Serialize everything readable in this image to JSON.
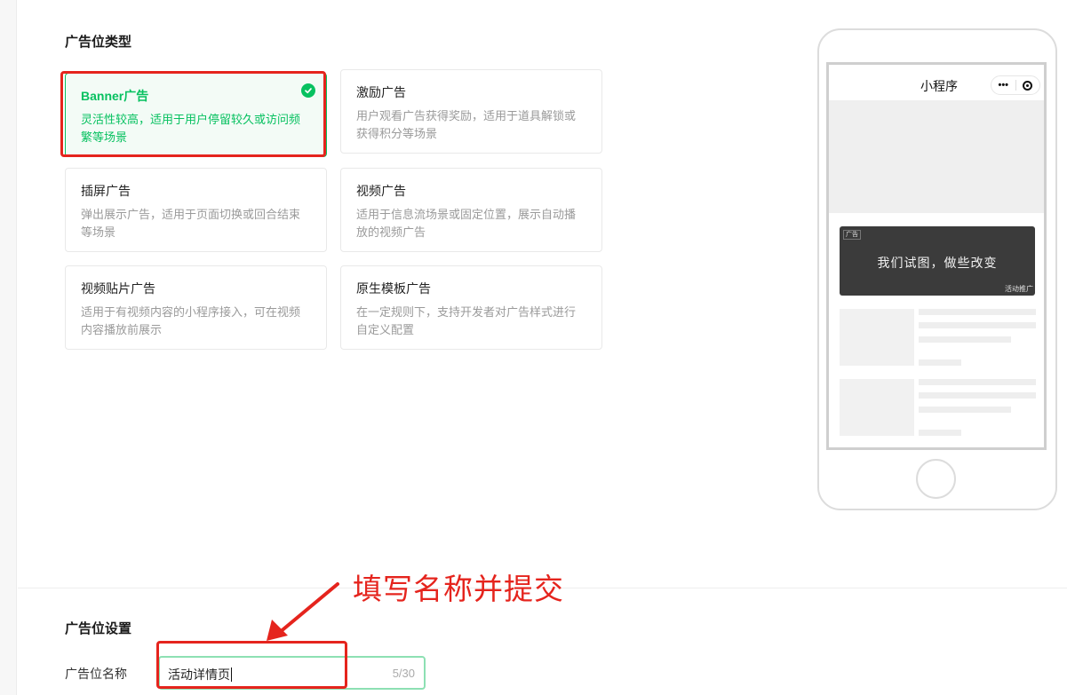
{
  "ad_type_section": {
    "title": "广告位类型"
  },
  "ad_types": [
    {
      "title": "Banner广告",
      "desc_line1": "灵活性较高，适用于用户停留较久或访问频",
      "desc_line2": "繁等场景",
      "selected": true
    },
    {
      "title": "激励广告",
      "desc_line1": "用户观看广告获得奖励，适用于道具解锁或",
      "desc_line2": "获得积分等场景",
      "selected": false
    },
    {
      "title": "插屏广告",
      "desc_line1": "弹出展示广告，适用于页面切换或回合结束",
      "desc_line2": "等场景",
      "selected": false
    },
    {
      "title": "视频广告",
      "desc_line1": "适用于信息流场景或固定位置，展示自动播",
      "desc_line2": "放的视频广告",
      "selected": false
    },
    {
      "title": "视频贴片广告",
      "desc_line1": "适用于有视频内容的小程序接入，可在视频",
      "desc_line2": "内容播放前展示",
      "selected": false
    },
    {
      "title": "原生模板广告",
      "desc_line1": "在一定规则下，支持开发者对广告样式进行",
      "desc_line2": "自定义配置",
      "selected": false
    }
  ],
  "preview": {
    "miniprogram_title": "小程序",
    "capsule_more": "•••",
    "banner_tag": "广告",
    "banner_slogan": "我们试图，做些改变",
    "banner_promo": "活动推广"
  },
  "settings_section": {
    "title": "广告位设置"
  },
  "name_field": {
    "label": "广告位名称",
    "value": "活动详情页",
    "counter": "5/30"
  },
  "annotation": {
    "text": "填写名称并提交"
  },
  "colors": {
    "accent": "#07c160",
    "annotation_red": "#e5241d"
  }
}
